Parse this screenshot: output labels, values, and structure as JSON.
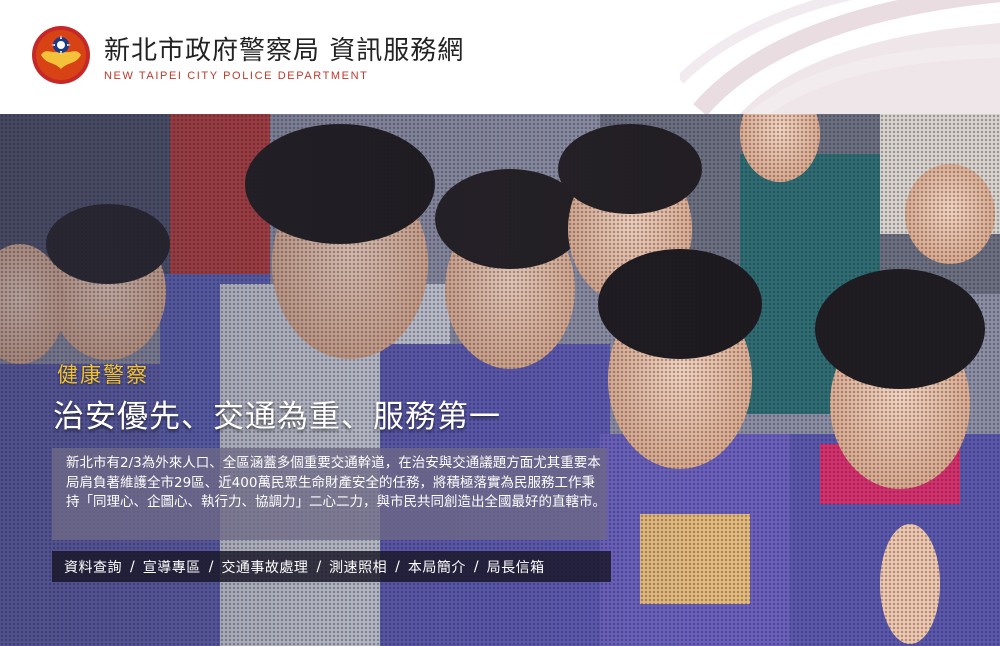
{
  "header": {
    "title": "新北市政府警察局 資訊服務網",
    "subtitle": "NEW TAIPEI CITY POLICE DEPARTMENT"
  },
  "hero": {
    "tag": "健康警察",
    "headline": "治安優先、交通為重、服務第一",
    "description": "新北市有2/3為外來人口、全區涵蓋多個重要交通幹道，在治安與交通議題方面尤其重要本局肩負著維護全市29區、近400萬民眾生命財產安全的任務，將積極落實為民服務工作秉持「同理心、企圖心、執行力、協調力」二心二力，與市民共同創造出全國最好的直轄市。"
  },
  "nav": {
    "items": [
      "資料查詢",
      "宣導專區",
      "交通事故處理",
      "測速照相",
      "本局簡介",
      "局長信箱"
    ],
    "separator": "/"
  },
  "colors": {
    "accent_yellow": "#f2c230",
    "brand_red": "#c0392b"
  }
}
